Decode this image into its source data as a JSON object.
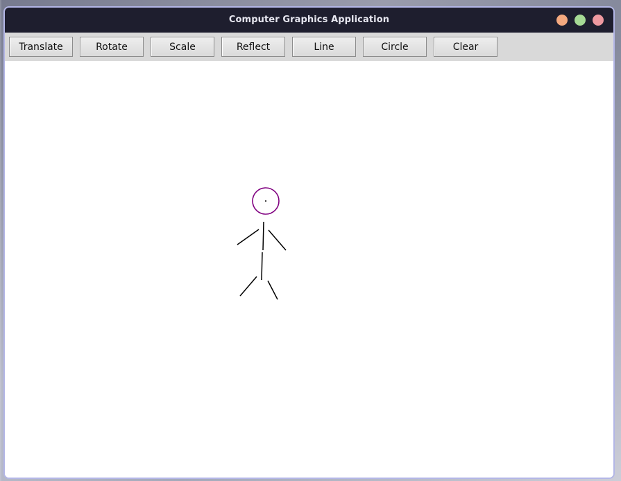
{
  "window": {
    "title": "Computer Graphics Application",
    "controls": [
      {
        "name": "minimize",
        "color": "#f5a97f"
      },
      {
        "name": "maximize",
        "color": "#a6da95"
      },
      {
        "name": "close",
        "color": "#ee99a0"
      }
    ]
  },
  "toolbar": {
    "buttons": [
      "Translate",
      "Rotate",
      "Scale",
      "Reflect",
      "Line",
      "Circle",
      "Clear"
    ]
  },
  "canvas": {
    "drawing": "stick-figure",
    "head_color": "#800080",
    "body_color": "#000000"
  }
}
